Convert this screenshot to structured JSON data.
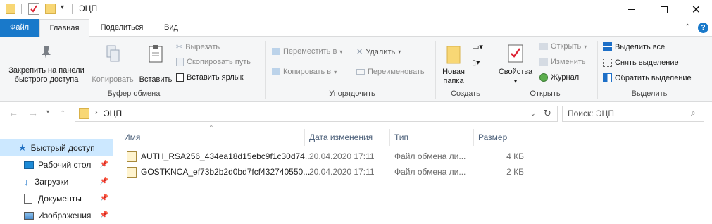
{
  "titlebar": {
    "folder_name": "ЭЦП"
  },
  "tabs": {
    "file": "Файл",
    "home": "Главная",
    "share": "Поделиться",
    "view": "Вид"
  },
  "ribbon": {
    "clipboard": {
      "pin_label_1": "Закрепить на панели",
      "pin_label_2": "быстрого доступа",
      "copy": "Копировать",
      "paste": "Вставить",
      "cut": "Вырезать",
      "copy_path": "Скопировать путь",
      "paste_shortcut": "Вставить ярлык",
      "group_label": "Буфер обмена"
    },
    "organize": {
      "move_to": "Переместить в",
      "copy_to": "Копировать в",
      "delete": "Удалить",
      "rename": "Переименовать",
      "group_label": "Упорядочить"
    },
    "new": {
      "new_folder_1": "Новая",
      "new_folder_2": "папка",
      "group_label": "Создать"
    },
    "open": {
      "properties": "Свойства",
      "open": "Открыть",
      "edit": "Изменить",
      "history": "Журнал",
      "group_label": "Открыть"
    },
    "select": {
      "select_all": "Выделить все",
      "select_none": "Снять выделение",
      "invert": "Обратить выделение",
      "group_label": "Выделить"
    }
  },
  "address": {
    "path": "ЭЦП",
    "search_placeholder": "Поиск: ЭЦП"
  },
  "columns": [
    "Имя",
    "Дата изменения",
    "Тип",
    "Размер"
  ],
  "files": [
    {
      "name": "AUTH_RSA256_434ea18d15ebc9f1c30d74...",
      "date": "20.04.2020 17:11",
      "type": "Файл обмена ли...",
      "size": "4 КБ"
    },
    {
      "name": "GOSTKNCA_ef73b2b2d0bd7fcf432740550...",
      "date": "20.04.2020 17:11",
      "type": "Файл обмена ли...",
      "size": "2 КБ"
    }
  ],
  "nav": {
    "quick_access": "Быстрый доступ",
    "desktop": "Рабочий стол",
    "downloads": "Загрузки",
    "documents": "Документы",
    "pictures": "Изображения"
  },
  "colors": {
    "file_tab": "#1979ca",
    "selection": "#cce8ff",
    "ribbon_bg": "#f5f6f7"
  }
}
